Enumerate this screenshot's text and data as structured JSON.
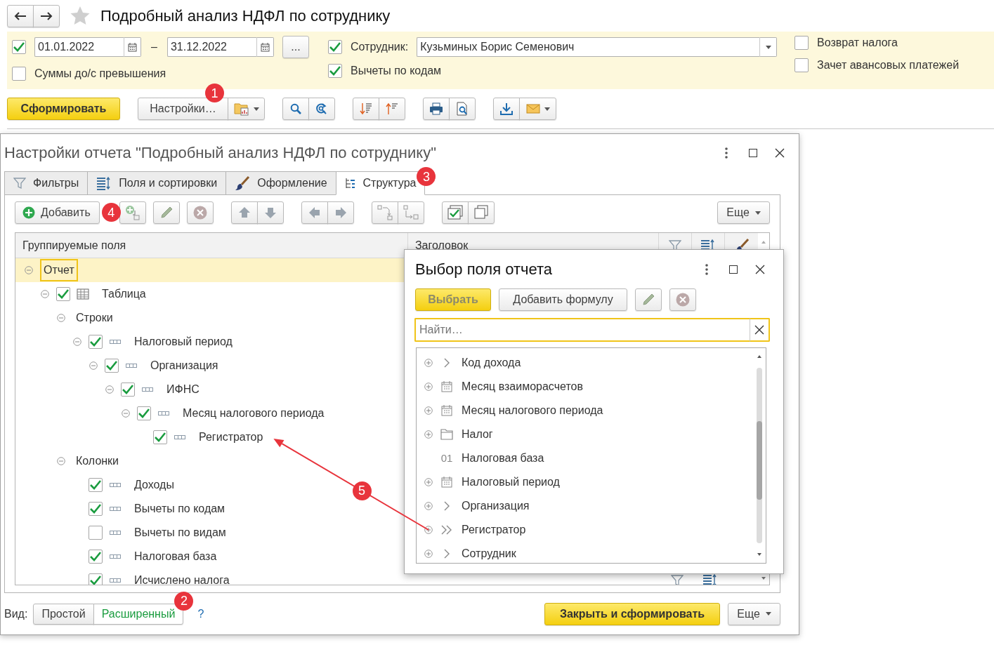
{
  "header": {
    "title": "Подробный анализ НДФЛ по сотруднику"
  },
  "filters": {
    "period": {
      "checked": true,
      "from": "01.01.2022",
      "separator": "–",
      "to": "31.12.2022",
      "more_button": "..."
    },
    "exceed": {
      "label": "Суммы до/с превышения",
      "checked": false
    },
    "employee": {
      "checked": true,
      "label": "Сотрудник:",
      "value": "Кузьминых Борис Семенович"
    },
    "deductions": {
      "label": "Вычеты по кодам",
      "checked": true
    },
    "options": [
      {
        "label": "Возврат налога",
        "checked": false
      },
      {
        "label": "Зачет авансовых платежей",
        "checked": false
      }
    ]
  },
  "toolbar": {
    "generate_button": "Сформировать",
    "settings_button": {
      "label": "Настройки…",
      "badge": "1"
    }
  },
  "settings_dialog": {
    "title": "Настройки отчета \"Подробный анализ НДФЛ по сотруднику\"",
    "tabs": [
      {
        "label": "Фильтры",
        "selected": false
      },
      {
        "label": "Поля и сортировки",
        "selected": false
      },
      {
        "label": "Оформление",
        "selected": false
      },
      {
        "label": "Структура",
        "selected": true,
        "badge": "3"
      }
    ],
    "add_button": {
      "label": "Добавить",
      "badge": "4"
    },
    "more_button": "Еще",
    "columns": [
      "Группируемые поля",
      "Заголовок"
    ],
    "tree": [
      {
        "label": "Отчет",
        "expanded": true,
        "selected": true,
        "children": [
          {
            "label": "Таблица",
            "kind": "table",
            "checked": true,
            "expanded": true,
            "selected": false,
            "children": [
              {
                "label": "Строки",
                "expanded": true,
                "selected": false,
                "children": [
                  {
                    "label": "Налоговый период",
                    "kind": "field",
                    "checked": true,
                    "expanded": true,
                    "selected": false,
                    "children": [
                      {
                        "label": "Организация",
                        "kind": "field",
                        "checked": true,
                        "expanded": true,
                        "selected": false,
                        "children": [
                          {
                            "label": "ИФНС",
                            "kind": "field",
                            "checked": true,
                            "expanded": true,
                            "selected": false,
                            "children": [
                              {
                                "label": "Месяц налогового периода",
                                "kind": "field",
                                "checked": true,
                                "expanded": true,
                                "selected": false,
                                "children": [
                                  {
                                    "label": "Регистратор",
                                    "kind": "field",
                                    "checked": true,
                                    "selected": false,
                                    "arrow_target": true
                                  }
                                ]
                              }
                            ]
                          }
                        ]
                      }
                    ]
                  }
                ]
              },
              {
                "label": "Колонки",
                "expanded": true,
                "selected": false,
                "children": [
                  {
                    "label": "Доходы",
                    "kind": "field",
                    "checked": true,
                    "selected": false
                  },
                  {
                    "label": "Вычеты по кодам",
                    "kind": "field",
                    "checked": true,
                    "selected": false
                  },
                  {
                    "label": "Вычеты по видам",
                    "kind": "field",
                    "checked": false,
                    "selected": false
                  },
                  {
                    "label": "Налоговая база",
                    "kind": "field",
                    "checked": true,
                    "selected": false
                  },
                  {
                    "label": "Исчислено налога",
                    "kind": "field",
                    "checked": true,
                    "selected": false
                  }
                ]
              }
            ]
          }
        ]
      }
    ],
    "view_label": "Вид:",
    "view_modes": [
      {
        "label": "Простой",
        "selected": false
      },
      {
        "label": "Расширенный",
        "selected": true,
        "badge": "2"
      }
    ],
    "help": "?",
    "close_button": "Закрыть и сформировать",
    "bottom_more_button": "Еще"
  },
  "field_picker": {
    "title": "Выбор поля отчета",
    "select_button": {
      "label": "Выбрать",
      "disabled": true
    },
    "formula_button": "Добавить формулу",
    "search": {
      "placeholder": "Найти…"
    },
    "fields": [
      {
        "label": "Код дохода",
        "kind": "reference",
        "expandable": true,
        "selected": false
      },
      {
        "label": "Месяц взаиморасчетов",
        "kind": "date",
        "expandable": true,
        "selected": false
      },
      {
        "label": "Месяц налогового периода",
        "kind": "date",
        "expandable": true,
        "selected": false
      },
      {
        "label": "Налог",
        "kind": "folder",
        "expandable": true,
        "selected": false
      },
      {
        "label": "Налоговая база",
        "kind": "number",
        "icon_text": "01",
        "expandable": false,
        "selected": false
      },
      {
        "label": "Налоговый период",
        "kind": "date",
        "expandable": true,
        "selected": false
      },
      {
        "label": "Организация",
        "kind": "reference",
        "expandable": true,
        "selected": false
      },
      {
        "label": "Регистратор",
        "kind": "document",
        "expandable": true,
        "selected": false,
        "arrow_target": true
      },
      {
        "label": "Сотрудник",
        "kind": "reference",
        "expandable": true,
        "selected": false
      }
    ]
  },
  "annotation_arrow": {
    "badge": "5"
  }
}
